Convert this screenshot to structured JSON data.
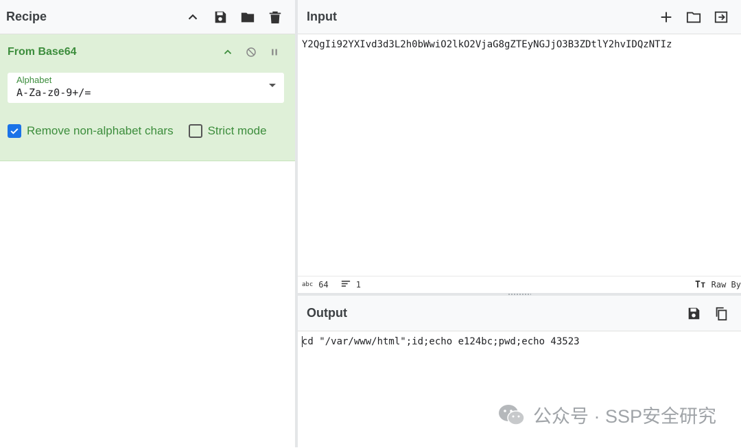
{
  "recipe": {
    "title": "Recipe",
    "operation": {
      "name": "From Base64",
      "alphabet_label": "Alphabet",
      "alphabet_value": "A-Za-z0-9+/=",
      "remove_non_alphabet": {
        "label": "Remove non-alphabet chars",
        "checked": true
      },
      "strict_mode": {
        "label": "Strict mode",
        "checked": false
      }
    }
  },
  "input": {
    "title": "Input",
    "text": "Y2QgIi92YXIvd3d3L2h0bWwiO2lkO2VjaG8gZTEyNGJjO3B3ZDtlY2hvIDQzNTIz",
    "status": {
      "length": "64",
      "lines": "1",
      "encoding": "Raw By"
    }
  },
  "output": {
    "title": "Output",
    "text": "cd \"/var/www/html\";id;echo e124bc;pwd;echo 43523"
  },
  "watermark": {
    "text": "公众号 · SSP安全研究"
  },
  "colors": {
    "accent_green": "#3c8d3c",
    "op_bg": "#dff0d8",
    "checkbox_blue": "#1a73e8"
  },
  "icons": [
    "chevron-up-icon",
    "save-icon",
    "folder-icon",
    "trash-icon",
    "disable-icon",
    "pause-icon",
    "plus-icon",
    "open-folder-icon",
    "replace-input-icon",
    "copy-icon",
    "text-size-icon",
    "lines-icon",
    "wechat-icon"
  ]
}
